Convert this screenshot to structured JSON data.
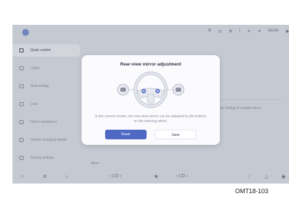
{
  "status_bar": {
    "icons": [
      "r-icon",
      "eye-icon",
      "settings-icon",
      "separator-icon",
      "mute-icon",
      "bluetooth-icon",
      "signal-icon",
      "wifi-icon"
    ],
    "labels": [
      "R",
      "◎",
      "⚙",
      "|",
      "✕",
      "✦",
      "04:04",
      "◉"
    ]
  },
  "sidebar": {
    "items": [
      {
        "label": "Quick control",
        "active": true,
        "icon": "car-icon"
      },
      {
        "label": "Lights",
        "active": false,
        "icon": "light-icon"
      },
      {
        "label": "Seat setting",
        "active": false,
        "icon": "seat-icon"
      },
      {
        "label": "Lock",
        "active": false,
        "icon": "lock-icon"
      },
      {
        "label": "Driver assistance",
        "active": false,
        "icon": "assist-icon"
      },
      {
        "label": "Vehicle charging details",
        "active": false,
        "icon": "charge-icon"
      },
      {
        "label": "Driving settings",
        "active": false,
        "icon": "drive-icon"
      }
    ]
  },
  "content": {
    "more_label": "More",
    "right_text": "Auto folding of outside mirror"
  },
  "modal": {
    "title": "Rear-view mirror adjustment",
    "description": "In the current screen, the rear-view mirror can be adjusted by the buttons on the steering wheel.",
    "reset_label": "Reset",
    "save_label": "Save"
  },
  "bottom_bar": {
    "home": "⌂",
    "fan": "✲",
    "seat": "∟",
    "left_temp": "‹  LO  ›",
    "fan_center": "❀",
    "right_temp": "‹  LO  ›",
    "vent1": "⟋",
    "vent2": "△",
    "power": "◉"
  },
  "caption": "OMT18-103"
}
